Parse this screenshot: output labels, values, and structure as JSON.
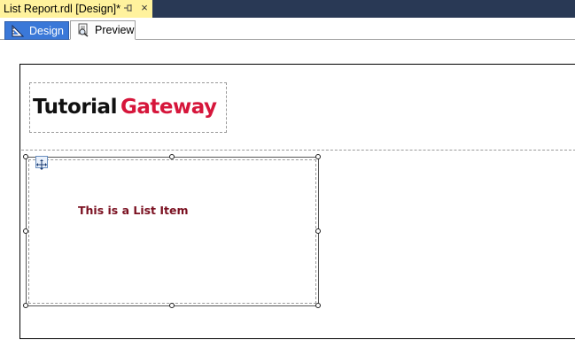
{
  "document_tab": {
    "title": "List Report.rdl [Design]*",
    "pin_icon": "pin-icon",
    "close_icon": "close-icon",
    "close_glyph": "×",
    "pin_glyph": "⊣"
  },
  "view_tabs": [
    {
      "label": "Design",
      "icon": "design-ruler-icon",
      "selected": true
    },
    {
      "label": "Preview",
      "icon": "preview-icon",
      "selected": false
    }
  ],
  "report": {
    "logo": {
      "part1": "Tutorial",
      "part2": "Gateway"
    },
    "list_item_text": "This is a List Item"
  },
  "colors": {
    "tab_strip": "#293955",
    "active_doc_tab": "#fff29d",
    "design_tab": "#3a78d8",
    "logo_accent": "#d6163b",
    "list_text": "#7a1020"
  }
}
